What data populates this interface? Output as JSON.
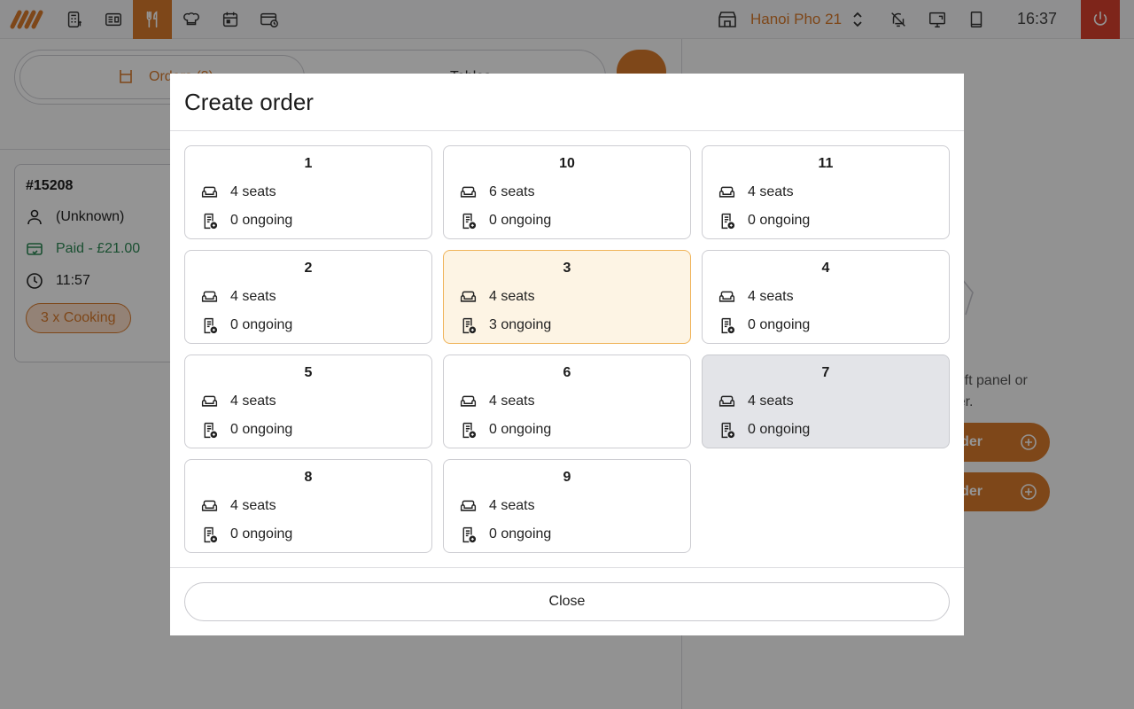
{
  "topbar": {
    "nav_icons": [
      "pos-terminal-icon",
      "receipt-icon",
      "restaurant-icon",
      "chef-hat-icon",
      "calendar-icon",
      "card-clock-icon"
    ],
    "active_nav": "restaurant-icon",
    "store_name": "Hanoi Pho 21",
    "time": "16:37"
  },
  "background": {
    "segment": {
      "orders_label": "Orders (3)",
      "tables_label": "Tables"
    },
    "order_card": {
      "number": "#15208",
      "customer": "(Unknown)",
      "payment": "Paid - £21.00",
      "time": "11:57",
      "status": "3 x Cooking"
    },
    "right_panel": {
      "empty_line1": "Select an order from the left panel or",
      "empty_line2": "create a new order.",
      "button1": "New order",
      "button2": "New table order"
    }
  },
  "modal": {
    "title": "Create order",
    "tables": [
      {
        "name": "1",
        "seats": "4 seats",
        "ongoing": "0 ongoing",
        "state": "normal"
      },
      {
        "name": "10",
        "seats": "6 seats",
        "ongoing": "0 ongoing",
        "state": "normal"
      },
      {
        "name": "11",
        "seats": "4 seats",
        "ongoing": "0 ongoing",
        "state": "normal"
      },
      {
        "name": "2",
        "seats": "4 seats",
        "ongoing": "0 ongoing",
        "state": "normal"
      },
      {
        "name": "3",
        "seats": "4 seats",
        "ongoing": "3 ongoing",
        "state": "selected"
      },
      {
        "name": "4",
        "seats": "4 seats",
        "ongoing": "0 ongoing",
        "state": "normal"
      },
      {
        "name": "5",
        "seats": "4 seats",
        "ongoing": "0 ongoing",
        "state": "normal"
      },
      {
        "name": "6",
        "seats": "4 seats",
        "ongoing": "0 ongoing",
        "state": "normal"
      },
      {
        "name": "7",
        "seats": "4 seats",
        "ongoing": "0 ongoing",
        "state": "disabled"
      },
      {
        "name": "8",
        "seats": "4 seats",
        "ongoing": "0 ongoing",
        "state": "normal"
      },
      {
        "name": "9",
        "seats": "4 seats",
        "ongoing": "0 ongoing",
        "state": "normal"
      }
    ],
    "close_label": "Close"
  },
  "colors": {
    "accent": "#d97a2b",
    "power": "#d9412e",
    "paid": "#2f8a57",
    "selected_bg": "#fdf4e4",
    "selected_border": "#f0b45a",
    "disabled_bg": "#e3e4e8"
  }
}
